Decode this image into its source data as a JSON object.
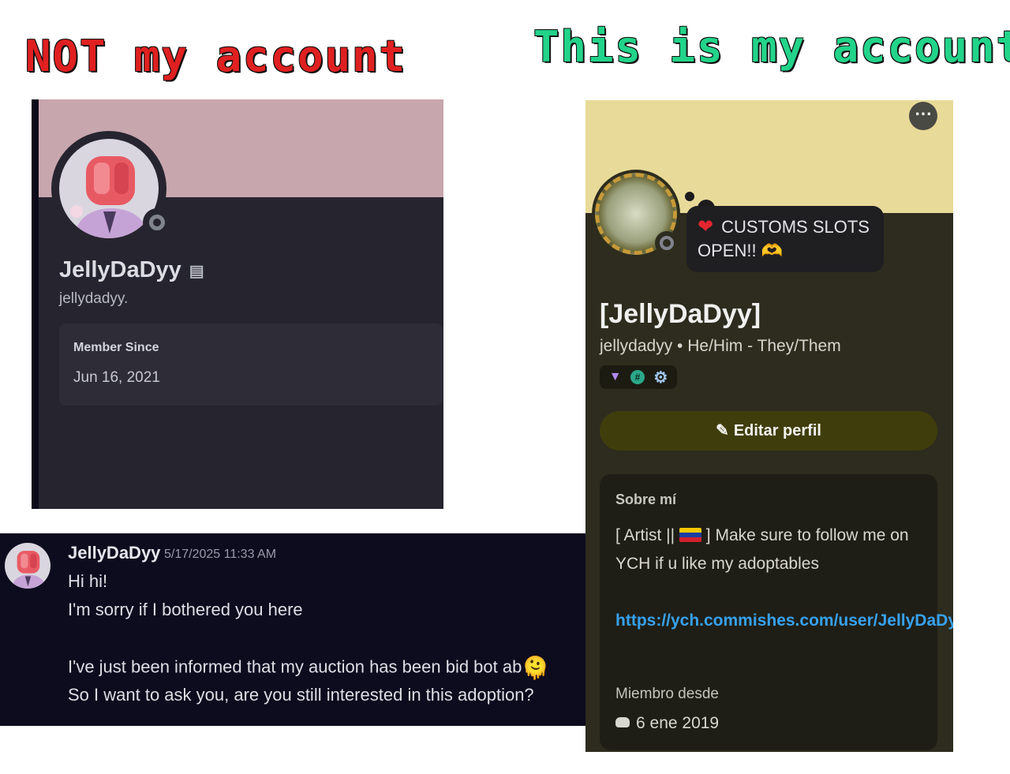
{
  "headings": {
    "left": "NOT my account",
    "right": "This is my account"
  },
  "fake_profile": {
    "display_name": "JellyDaDyy",
    "username": "jellydadyy.",
    "member_since_label": "Member Since",
    "member_since_date": "Jun 16, 2021",
    "banner_color": "#c8a6ae",
    "status_icon": "offline-status-icon",
    "name_icon": "note-icon"
  },
  "chat_message": {
    "author": "JellyDaDyy",
    "timestamp": "5/17/2025 11:33 AM",
    "lines": [
      "Hi hi!",
      "I'm sorry if I bothered you here",
      "I've just been informed that my auction has been bid bot ab",
      "So I want to ask you, are you still interested in this adoption?"
    ],
    "emoji": "🫠"
  },
  "real_profile": {
    "status_bubble": "CUSTOMS SLOTS OPEN!!",
    "heart_emoji": "❤",
    "hands_emoji": "🫶",
    "display_name": "[JellyDaDyy]",
    "subtitle": "jellydadyy • He/Him - They/Them",
    "edit_button": "Editar perfil",
    "about_title": "Sobre mí",
    "about_text_before": "[ Artist ||",
    "about_text_after": "] Make sure to follow me on YCH if u like my adoptables",
    "about_link": "https://ych.commishes.com/user/JellyDaDyy/",
    "member_since_label": "Miembro desde",
    "member_since_date": "6 ene 2019",
    "banner_color": "#e8da98",
    "more_icon": "more-options-icon",
    "badges": [
      "nitro-badge-icon",
      "hashtag-badge-icon",
      "gear-badge-icon"
    ]
  }
}
